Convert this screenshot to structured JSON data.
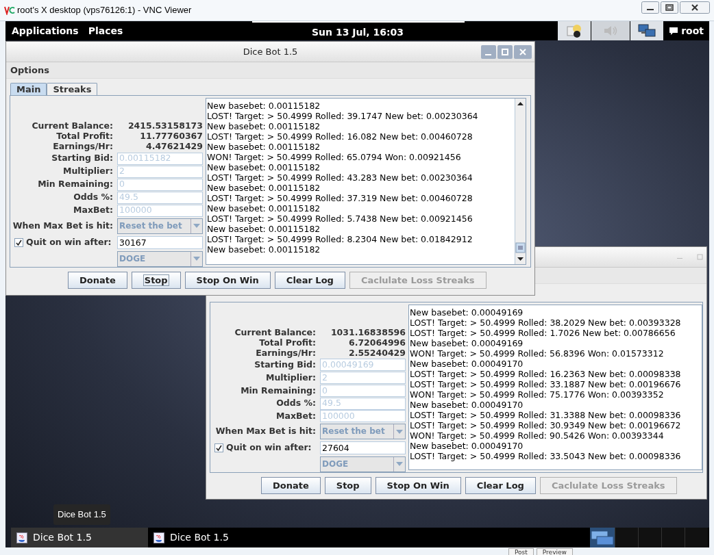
{
  "viewer": {
    "title": "root's X desktop (vps76126:1) - VNC Viewer"
  },
  "top_panel": {
    "menus": [
      "Applications",
      "Places"
    ],
    "clock": "Sun 13 Jul, 16:03",
    "user": "root"
  },
  "windows": [
    {
      "title": "Dice Bot 1.5",
      "menu": "Options",
      "tabs": [
        {
          "label": "Main",
          "selected": true
        },
        {
          "label": "Streaks",
          "selected": false
        }
      ],
      "stats": [
        {
          "label": "Current Balance:",
          "value": "2415.53158173"
        },
        {
          "label": "Total Profit:",
          "value": "11.77760367"
        },
        {
          "label": "Earnings/Hr:",
          "value": "4.47621429"
        }
      ],
      "fields": [
        {
          "label": "Starting Bid:",
          "value": "0.00115182",
          "disabled": true
        },
        {
          "label": "Multiplier:",
          "value": "2",
          "disabled": true
        },
        {
          "label": "Min Remaining:",
          "value": "0",
          "disabled": true
        },
        {
          "label": "Odds %:",
          "value": "49.5",
          "disabled": true
        },
        {
          "label": "MaxBet:",
          "value": "100000",
          "disabled": true
        }
      ],
      "max_bet_action": {
        "label": "When Max Bet is hit:",
        "value": "Reset the bet",
        "disabled": true
      },
      "quit": {
        "label": "Quit on win after:",
        "checked": true,
        "value": "30167"
      },
      "currency": {
        "value": "DOGE",
        "disabled": true
      },
      "log": [
        "New basebet: 0.00115182",
        "LOST! Target: > 50.4999 Rolled: 39.1747 New bet: 0.00230364",
        "New basebet: 0.00115182",
        "LOST! Target: > 50.4999 Rolled: 16.082 New bet: 0.00460728",
        "New basebet: 0.00115182",
        "WON! Target: > 50.4999 Rolled: 65.0794 Won: 0.00921456",
        "New basebet: 0.00115182",
        "LOST! Target: > 50.4999 Rolled: 43.283 New bet: 0.00230364",
        "New basebet: 0.00115182",
        "LOST! Target: > 50.4999 Rolled: 37.319 New bet: 0.00460728",
        "New basebet: 0.00115182",
        "LOST! Target: > 50.4999 Rolled: 5.7438 New bet: 0.00921456",
        "New basebet: 0.00115182",
        "LOST! Target: > 50.4999 Rolled: 8.2304 New bet: 0.01842912",
        "New basebet: 0.00115182"
      ],
      "buttons": [
        {
          "label": "Donate",
          "disabled": false,
          "focused": false
        },
        {
          "label": "Stop",
          "disabled": false,
          "focused": true
        },
        {
          "label": "Stop On Win",
          "disabled": false,
          "focused": false
        },
        {
          "label": "Clear Log",
          "disabled": false,
          "focused": false
        },
        {
          "label": "Caclulate Loss Streaks",
          "disabled": true,
          "focused": false
        }
      ]
    },
    {
      "stats": [
        {
          "label": "Current Balance:",
          "value": "1031.16838596"
        },
        {
          "label": "Total Profit:",
          "value": "6.72064996"
        },
        {
          "label": "Earnings/Hr:",
          "value": "2.55240429"
        }
      ],
      "fields": [
        {
          "label": "Starting Bid:",
          "value": "0.00049169",
          "disabled": true
        },
        {
          "label": "Multiplier:",
          "value": "2",
          "disabled": true
        },
        {
          "label": "Min Remaining:",
          "value": "0",
          "disabled": true
        },
        {
          "label": "Odds %:",
          "value": "49.5",
          "disabled": true
        },
        {
          "label": "MaxBet:",
          "value": "100000",
          "disabled": true
        }
      ],
      "max_bet_action": {
        "label": "When Max Bet is hit:",
        "value": "Reset the bet",
        "disabled": true
      },
      "quit": {
        "label": "Quit on win after:",
        "checked": true,
        "value": "27604"
      },
      "currency": {
        "value": "DOGE",
        "disabled": true
      },
      "log": [
        "New basebet: 0.00049169",
        "LOST! Target: > 50.4999 Rolled: 38.2029 New bet: 0.00393328",
        "LOST! Target: > 50.4999 Rolled: 1.7026 New bet: 0.00786656",
        "New basebet: 0.00049169",
        "WON! Target: > 50.4999 Rolled: 56.8396 Won: 0.01573312",
        "New basebet: 0.00049170",
        "LOST! Target: > 50.4999 Rolled: 16.2363 New bet: 0.00098338",
        "LOST! Target: > 50.4999 Rolled: 33.1887 New bet: 0.00196676",
        "WON! Target: > 50.4999 Rolled: 75.1776 Won: 0.00393352",
        "New basebet: 0.00049170",
        "LOST! Target: > 50.4999 Rolled: 31.3388 New bet: 0.00098336",
        "LOST! Target: > 50.4999 Rolled: 30.9349 New bet: 0.00196672",
        "WON! Target: > 50.4999 Rolled: 90.5426 Won: 0.00393344",
        "New basebet: 0.00049170",
        "LOST! Target: > 50.4999 Rolled: 33.5043 New bet: 0.00098336"
      ],
      "buttons": [
        {
          "label": "Donate",
          "disabled": false,
          "focused": false
        },
        {
          "label": "Stop",
          "disabled": false,
          "focused": false
        },
        {
          "label": "Stop On Win",
          "disabled": false,
          "focused": false
        },
        {
          "label": "Clear Log",
          "disabled": false,
          "focused": false
        },
        {
          "label": "Caclulate Loss Streaks",
          "disabled": true,
          "focused": false
        }
      ]
    }
  ],
  "tooltip": "Dice Bot 1.5",
  "taskbar": [
    {
      "label": "Dice Bot 1.5",
      "selected": true
    },
    {
      "label": "Dice Bot 1.5",
      "selected": false
    }
  ],
  "bottom_buttons": [
    "Post",
    "Preview"
  ]
}
